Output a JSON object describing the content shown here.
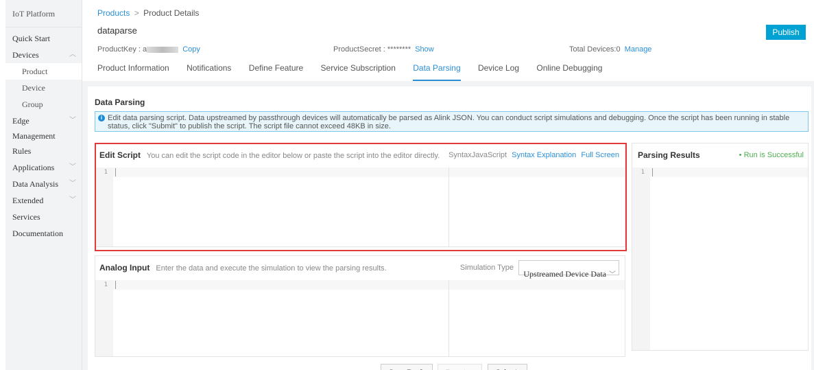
{
  "sidebar": {
    "title": "IoT Platform",
    "items": [
      {
        "label": "Quick Start",
        "chevron": ""
      },
      {
        "label": "Devices",
        "chevron": "^"
      },
      {
        "label": "Product",
        "chevron": ""
      },
      {
        "label": "Device",
        "chevron": ""
      },
      {
        "label": "Group",
        "chevron": ""
      },
      {
        "label": "Edge",
        "chevron": "v"
      },
      {
        "label": "Management",
        "chevron": ""
      },
      {
        "label": "Rules",
        "chevron": ""
      },
      {
        "label": "Applications",
        "chevron": "v"
      },
      {
        "label": "Data Analysis",
        "chevron": "v"
      },
      {
        "label": "Extended",
        "chevron": "v"
      },
      {
        "label": "Services",
        "chevron": ""
      },
      {
        "label": "Documentation",
        "chevron": ""
      }
    ]
  },
  "header": {
    "breadcrumb_link": "Products",
    "breadcrumb_sep": ">",
    "breadcrumb_current": "Product Details",
    "product_name": "dataparse",
    "publish_label": "Publish",
    "product_key_label": "ProductKey :",
    "product_key_prefix": "a",
    "copy_label": "Copy",
    "product_secret_label": "ProductSecret :",
    "product_secret_value": "********",
    "show_label": "Show",
    "total_devices_label": "Total Devices:",
    "total_devices_value": "0",
    "manage_label": "Manage"
  },
  "tabs": [
    {
      "label": "Product Information"
    },
    {
      "label": "Notifications"
    },
    {
      "label": "Define Feature"
    },
    {
      "label": "Service Subscription"
    },
    {
      "label": "Data Parsing"
    },
    {
      "label": "Device Log"
    },
    {
      "label": "Online Debugging"
    }
  ],
  "main": {
    "section_title": "Data Parsing",
    "info_text": "Edit data parsing script. Data upstreamed by passthrough devices will automatically be parsed as Alink JSON. You can conduct script simulations and debugging. Once the script has been running in stable status, click \"Submit\" to publish the script. The script file cannot exceed 48KB in size.",
    "edit_script": {
      "title": "Edit Script",
      "hint": "You can edit the script code in the editor below or paste the script into the editor directly.",
      "syntax_label": "SyntaxJavaScript",
      "syntax_link": "Syntax Explanation",
      "fullscreen_link": "Full Screen",
      "line_number": "1"
    },
    "analog_input": {
      "title": "Analog Input",
      "hint": "Enter the data and execute the simulation to view the parsing results.",
      "sim_type_label": "Simulation Type",
      "sim_type_value": "Upstreamed Device Data",
      "line_number": "1"
    },
    "parsing_results": {
      "title": "Parsing Results",
      "status": "• Run is Successful",
      "line_number": "1"
    },
    "buttons": {
      "save_draft": "Save Draft",
      "running": "Running",
      "submit": "Submit"
    }
  },
  "colors": {
    "accent": "#00a2d4",
    "link": "#2b8fd6",
    "highlight_frame": "#e4393c",
    "success": "#4caf50"
  }
}
